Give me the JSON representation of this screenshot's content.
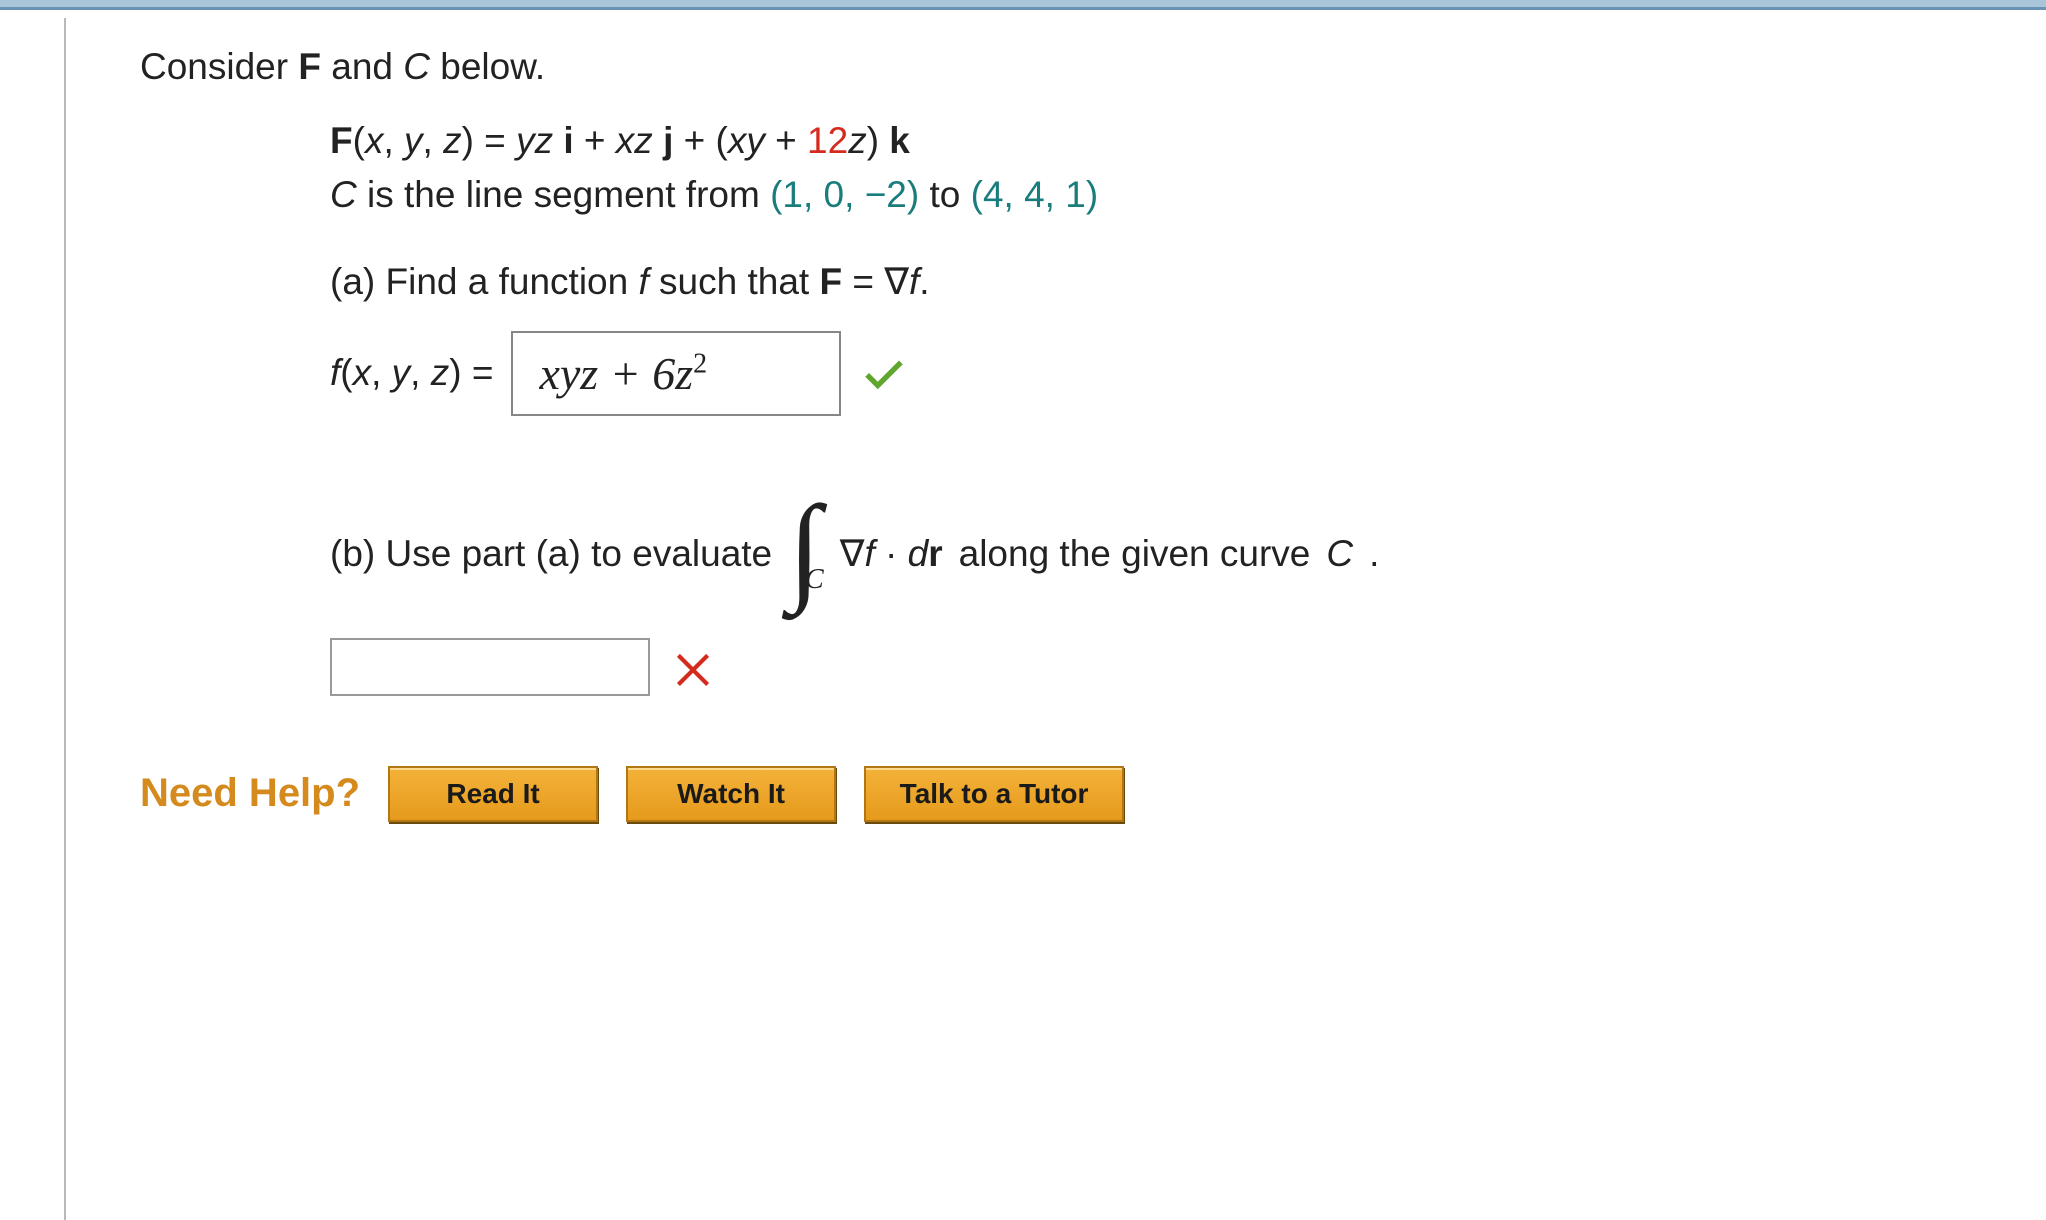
{
  "intro": {
    "prefix": "Consider ",
    "F": "F",
    "and": " and ",
    "C": "C",
    "suffix": " below."
  },
  "vector": {
    "lhs_F": "F",
    "lhs_args_open": "(",
    "x": "x",
    "comma1": ", ",
    "y": "y",
    "comma2": ", ",
    "z": "z",
    "lhs_args_close": ") = ",
    "term1_yz": "yz",
    "space1": " ",
    "i": "i",
    "plus1": " + ",
    "term2_xz": "xz",
    "space2": " ",
    "j": "j",
    "plus2": " + (",
    "term3_xy": "xy",
    "plus3": " + ",
    "coef12": "12",
    "term3_z": "z",
    "close_paren": ") ",
    "k": "k"
  },
  "curve": {
    "C": "C",
    "text1": " is the line segment from ",
    "p1_open": "(",
    "p1_a": "1",
    "p1_c1": ", ",
    "p1_b": "0",
    "p1_c2": ", ",
    "p1_c": "−2",
    "p1_close": ")",
    "to": " to ",
    "p2_open": "(",
    "p2_a": "4",
    "p2_c1": ", ",
    "p2_b": "4",
    "p2_c2": ", ",
    "p2_c": "1",
    "p2_close": ")"
  },
  "part_a": {
    "label": "(a) Find a function ",
    "f": "f",
    "mid": " such that ",
    "F": "F",
    "eq": " = ∇",
    "f2": "f",
    "period": ".",
    "answer_lhs_f": "f",
    "answer_lhs_open": "(",
    "answer_lhs_x": "x",
    "answer_lhs_c1": ", ",
    "answer_lhs_y": "y",
    "answer_lhs_c2": ", ",
    "answer_lhs_z": "z",
    "answer_lhs_close": ") = ",
    "answer_value_main": "xyz + 6z",
    "answer_value_exp": "2"
  },
  "part_b": {
    "label_pre": "(b) Use part (a) to evaluate ",
    "integral_sub": "C",
    "integrand_grad": "∇",
    "integrand_f": "f",
    "integrand_dot": " · ",
    "integrand_d": "d",
    "integrand_r": "r",
    "label_post": "  along the given curve ",
    "curve_C": "C",
    "period": ".",
    "answer_value": ""
  },
  "help": {
    "title": "Need Help?",
    "read": "Read It",
    "watch": "Watch It",
    "tutor": "Talk to a Tutor"
  }
}
